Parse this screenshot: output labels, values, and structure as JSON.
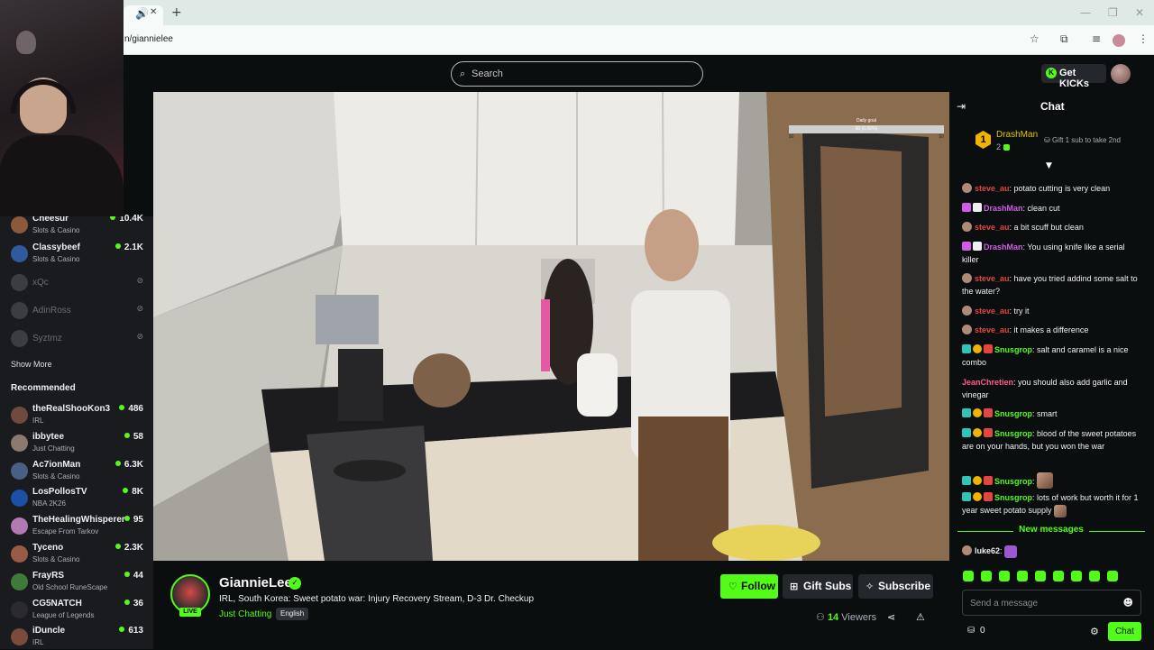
{
  "browser": {
    "url": "n/giannielee",
    "new_tab": "+",
    "tab_close": "✕",
    "tab_audio": "🔊",
    "window_min": "—",
    "window_restore": "❐",
    "window_close": "✕",
    "icons": [
      "bookmark-star-icon",
      "extensions-icon",
      "media-control-icon",
      "profile-icon",
      "menu-icon"
    ]
  },
  "topbar": {
    "search_placeholder": "Search",
    "get_kicks": "Get KICKs"
  },
  "sidebar": {
    "following": [
      {
        "name": "Cheesur",
        "category": "Slots & Casino",
        "viewers": "10.4K",
        "live": true,
        "color": "#8a5a3a"
      },
      {
        "name": "Classybeef",
        "category": "Slots & Casino",
        "viewers": "2.1K",
        "live": true,
        "color": "#2f5a9c"
      },
      {
        "name": "xQc",
        "category": "",
        "viewers": "",
        "live": false,
        "color": "#3b3d42"
      },
      {
        "name": "AdinRoss",
        "category": "",
        "viewers": "",
        "live": false,
        "color": "#3b3d42"
      },
      {
        "name": "Syztmz",
        "category": "",
        "viewers": "",
        "live": false,
        "color": "#3b3d42"
      }
    ],
    "show_more": "Show More",
    "recommended_title": "Recommended",
    "recommended": [
      {
        "name": "theRealShooKon3",
        "category": "IRL",
        "viewers": "486",
        "color": "#6e4b3e"
      },
      {
        "name": "ibbytee",
        "category": "Just Chatting",
        "viewers": "58",
        "color": "#8b7a6e"
      },
      {
        "name": "Ac7ionMan",
        "category": "Slots & Casino",
        "viewers": "6.3K",
        "color": "#4a5f86"
      },
      {
        "name": "LosPollosTV",
        "category": "NBA 2K26",
        "viewers": "8K",
        "color": "#1b4fa8"
      },
      {
        "name": "TheHealingWhisperer",
        "category": "Escape From Tarkov",
        "viewers": "95",
        "color": "#b27ab0"
      },
      {
        "name": "Tyceno",
        "category": "Slots & Casino",
        "viewers": "2.3K",
        "color": "#9a5b46"
      },
      {
        "name": "FrayRS",
        "category": "Old School RuneScape",
        "viewers": "44",
        "color": "#3f7a3a"
      },
      {
        "name": "CG5NATCH",
        "category": "League of Legends",
        "viewers": "36",
        "color": "#2a2a30"
      },
      {
        "name": "iDuncle",
        "category": "IRL",
        "viewers": "613",
        "color": "#7a4a3a"
      }
    ]
  },
  "overlay": {
    "goal_label": "Daily goal",
    "goal_value": "$0 (0.00%)",
    "goal_sub": "~ HOURS TO GO",
    "goal_min": "$0",
    "goal_max": "$0",
    "goal_progress": 0
  },
  "stream": {
    "channel": "GiannieLee",
    "live_label": "LIVE",
    "title": "IRL, South Korea: Sweet potato war: Injury Recovery Stream, D-3 Dr. Checkup",
    "category": "Just Chatting",
    "language": "English",
    "follow": "Follow",
    "gift_subs": "Gift Subs",
    "subscribe": "Subscribe",
    "viewers_count": "14",
    "viewers_label": "Viewers"
  },
  "chat": {
    "title": "Chat",
    "top_gifter": {
      "rank": "1",
      "name": "DrashMan",
      "count": "2",
      "cta": "Gift 1 sub to take 2nd"
    },
    "messages": [
      {
        "user": "steve_au",
        "color": "#e3453f",
        "text": ": potato cutting is very clean"
      },
      {
        "user": "DrashMan",
        "color": "#d05ce3",
        "text": ": clean cut"
      },
      {
        "user": "steve_au",
        "color": "#e3453f",
        "text": ": a bit scuff but clean"
      },
      {
        "user": "DrashMan",
        "color": "#d05ce3",
        "text": ": You using knife like a serial killer"
      },
      {
        "user": "steve_au",
        "color": "#e3453f",
        "text": ": have you tried addind some salt to the water?"
      },
      {
        "user": "steve_au",
        "color": "#e3453f",
        "text": ": try it"
      },
      {
        "user": "steve_au",
        "color": "#e3453f",
        "text": ": it makes a difference"
      },
      {
        "user": "Snusgrop",
        "color": "#53fc18",
        "text": ": salt and caramel is a nice combo"
      },
      {
        "user": "JeanChretien",
        "color": "#ff5a8a",
        "text": ": you should also add garlic and vinegar"
      },
      {
        "user": "Snusgrop",
        "color": "#53fc18",
        "text": ": smart"
      },
      {
        "user": "Snusgrop",
        "color": "#53fc18",
        "text": ": blood of the sweet potatoes are on your hands, but you won the war"
      },
      {
        "user": "Snusgrop",
        "color": "#53fc18",
        "text": ":"
      },
      {
        "user": "Snusgrop",
        "color": "#53fc18",
        "text": ": lots of work but worth it for 1 year sweet potato supply"
      }
    ],
    "new_messages": "New messages",
    "latest": {
      "user": "luke62",
      "color": "#efeff1",
      "text": ":"
    },
    "input_placeholder": "Send a message",
    "points": "0",
    "send": "Chat"
  }
}
